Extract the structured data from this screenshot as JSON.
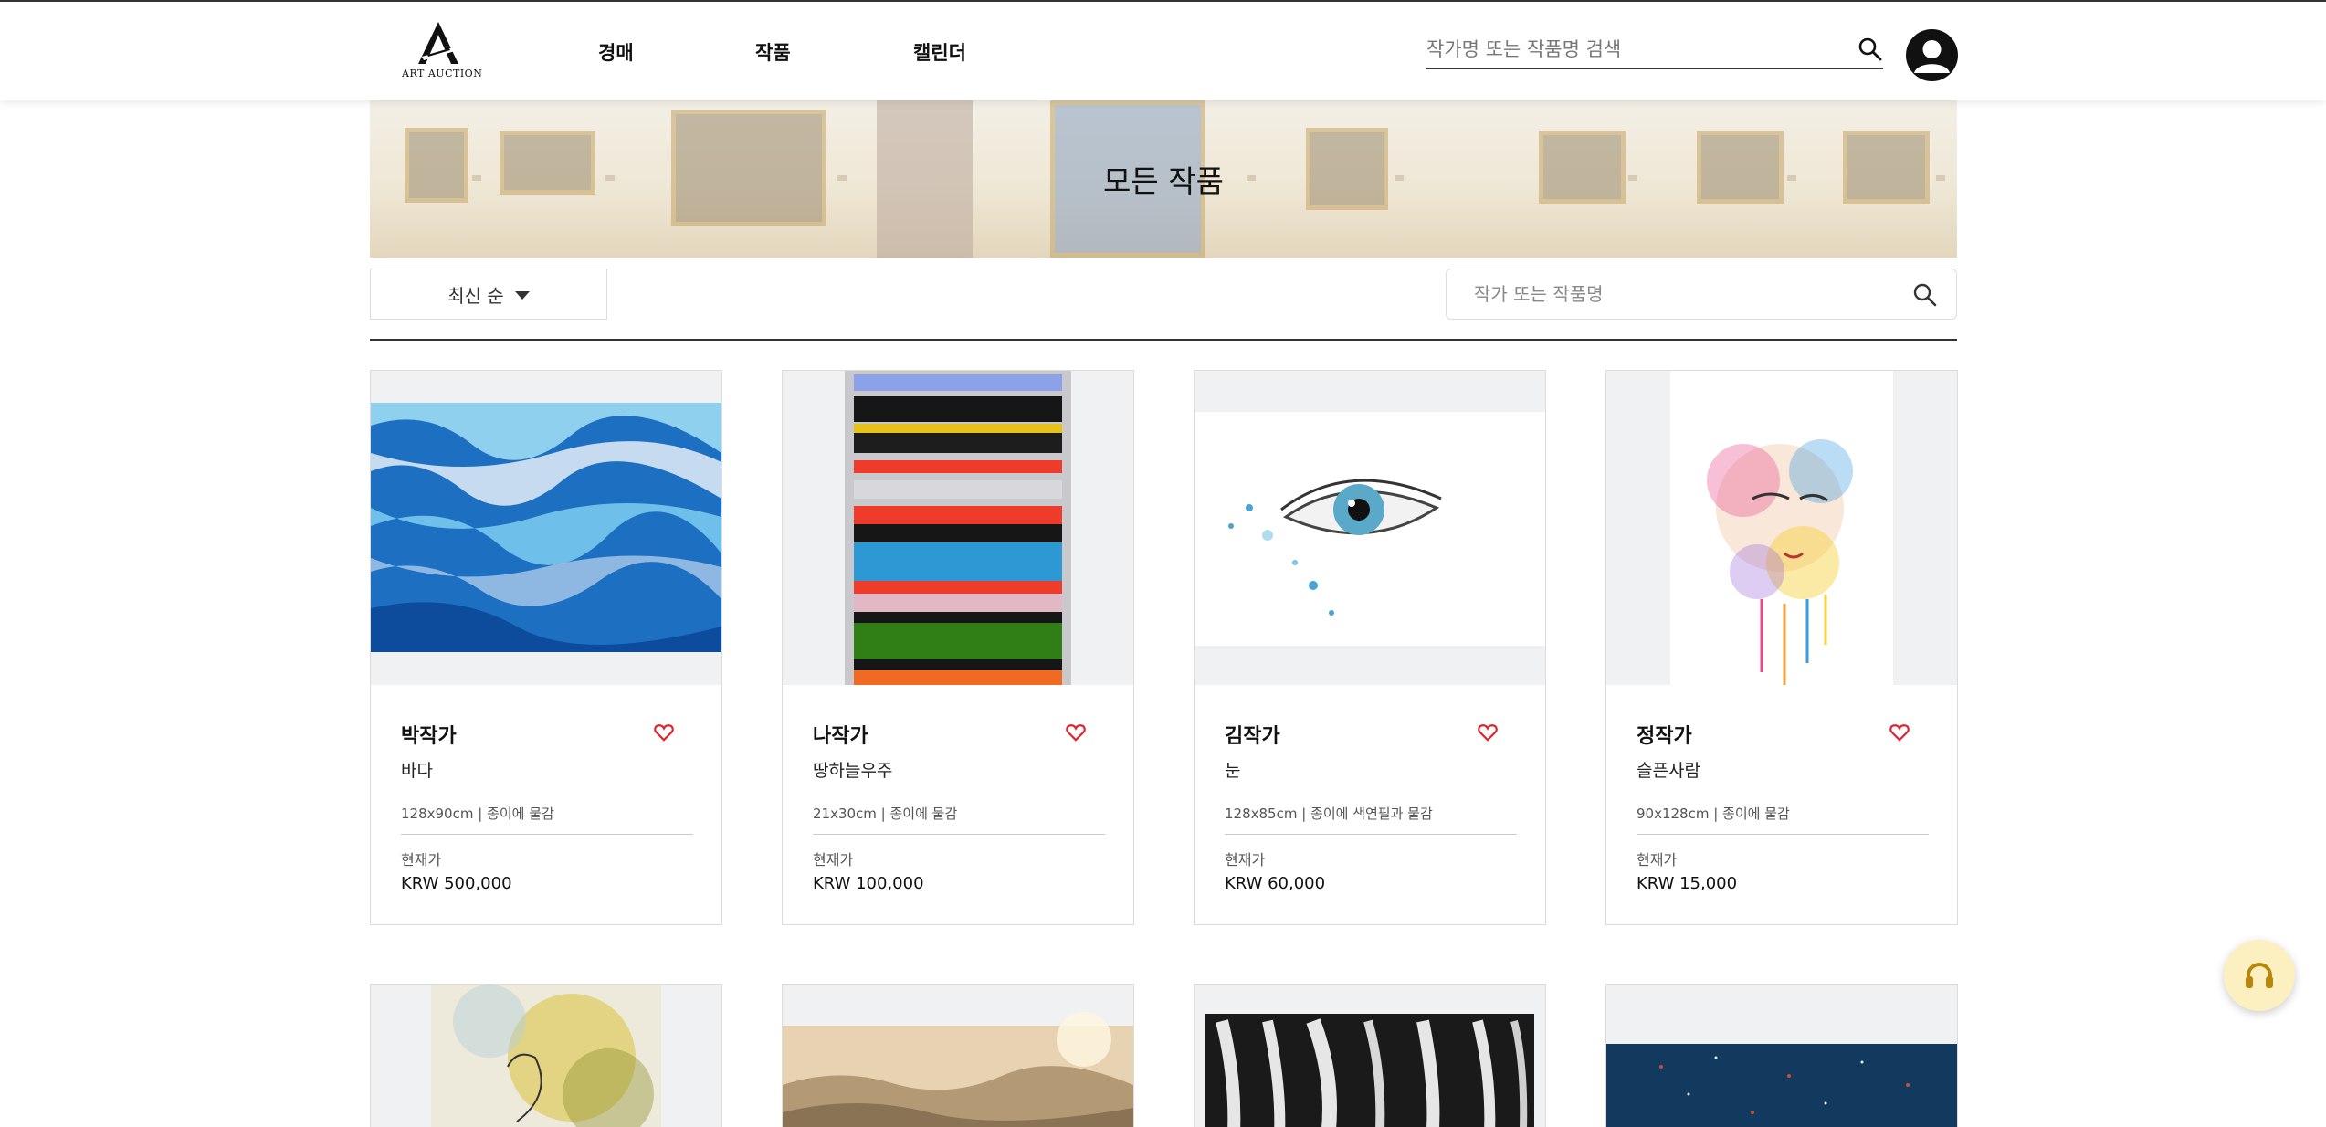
{
  "header": {
    "logo_text": "ART AUCTION",
    "nav": [
      "경매",
      "작품",
      "캘린더"
    ],
    "search_placeholder": "작가명 또는 작품명 검색"
  },
  "banner": {
    "title": "모든 작품"
  },
  "filter": {
    "sort_label": "최신 순",
    "search_placeholder": "작가 또는 작품명"
  },
  "artworks": [
    {
      "artist": "박작가",
      "title": "바다",
      "spec": "128x90cm | 종이에 물감",
      "price_label": "현재가",
      "price": "KRW 500,000"
    },
    {
      "artist": "나작가",
      "title": "땅하늘우주",
      "spec": "21x30cm | 종이에 물감",
      "price_label": "현재가",
      "price": "KRW 100,000"
    },
    {
      "artist": "김작가",
      "title": "눈",
      "spec": "128x85cm | 종이에 색연필과 물감",
      "price_label": "현재가",
      "price": "KRW 60,000"
    },
    {
      "artist": "정작가",
      "title": "슬픈사람",
      "spec": "90x128cm | 종이에 물감",
      "price_label": "현재가",
      "price": "KRW 15,000"
    }
  ],
  "colors": {
    "accent_heart": "#e0242e",
    "chat_button": "#fdf0c0",
    "chat_icon": "#b8860b"
  },
  "icons": [
    "logo-icon",
    "search-icon",
    "user-icon",
    "heart-icon",
    "caret-down-icon",
    "headset-icon"
  ]
}
